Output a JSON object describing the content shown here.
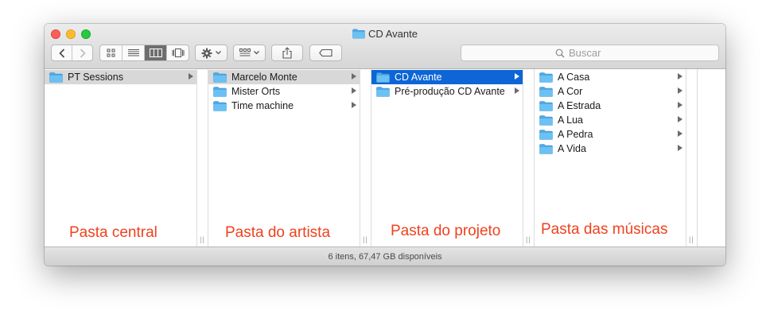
{
  "window": {
    "title": "CD Avante"
  },
  "search": {
    "placeholder": "Buscar"
  },
  "columns": [
    {
      "items": [
        {
          "label": "PT Sessions",
          "state": "path"
        }
      ],
      "caption": "Pasta central"
    },
    {
      "items": [
        {
          "label": "Marcelo Monte",
          "state": "path"
        },
        {
          "label": "Mister Orts",
          "state": "normal"
        },
        {
          "label": "Time machine",
          "state": "normal"
        }
      ],
      "caption": "Pasta do artista"
    },
    {
      "items": [
        {
          "label": "CD Avante",
          "state": "selected"
        },
        {
          "label": "Pré-produção CD Avante",
          "state": "normal"
        }
      ],
      "caption": "Pasta do projeto"
    },
    {
      "items": [
        {
          "label": "A Casa",
          "state": "normal"
        },
        {
          "label": "A Cor",
          "state": "normal"
        },
        {
          "label": "A Estrada",
          "state": "normal"
        },
        {
          "label": "A Lua",
          "state": "normal"
        },
        {
          "label": "A Pedra",
          "state": "normal"
        },
        {
          "label": "A Vida",
          "state": "normal"
        }
      ],
      "caption": "Pasta das músicas"
    }
  ],
  "status": {
    "text": "6 itens, 67,47 GB disponíveis"
  },
  "colors": {
    "selection": "#0d65d6",
    "path_highlight": "#d8d8d8",
    "annotation": "#f0411e",
    "folder": "#5eb7ee"
  },
  "icons": [
    "back-chevron-icon",
    "forward-chevron-icon",
    "icon-view-icon",
    "list-view-icon",
    "column-view-icon",
    "cover-flow-icon",
    "gear-icon",
    "arrange-icon",
    "share-icon",
    "tag-icon",
    "search-icon",
    "folder-icon",
    "disclosure-arrow-icon"
  ]
}
